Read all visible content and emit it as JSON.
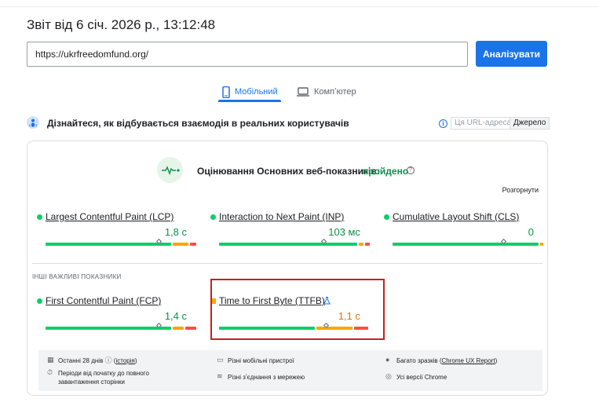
{
  "report": {
    "title": "Звіт від 6 січ. 2026 р., 13:12:48"
  },
  "search": {
    "url_value": "https://ukrfreedomfund.org/",
    "analyze_label": "Аналізувати"
  },
  "tabs": [
    {
      "label": "Мобільний",
      "active": true,
      "icon": "smartphone-icon"
    },
    {
      "label": "Компʼютер",
      "active": false,
      "icon": "laptop-icon"
    }
  ],
  "crux": {
    "heading": "Дізнайтеся, як відбувається взаємодія в реальних користувачів",
    "segment_url": "Ця URL-адреса",
    "segment_origin": "Джерело"
  },
  "assessment": {
    "label": "Оцінювання Основних веб-показників:",
    "result": "пройдено",
    "expand": "Розгорнути"
  },
  "metrics_core": [
    {
      "name": "Largest Contentful Paint (LCP)",
      "value": "1,8 с",
      "status": "good"
    },
    {
      "name": "Interaction to Next Paint (INP)",
      "value": "103 мс",
      "status": "good"
    },
    {
      "name": "Cumulative Layout Shift (CLS)",
      "value": "0",
      "status": "good"
    }
  ],
  "other_label": "ІНШІ ВАЖЛИВІ ПОКАЗНИКИ",
  "metrics_other": [
    {
      "name": "First Contentful Paint (FCP)",
      "value": "1,4 с",
      "status": "good"
    },
    {
      "name": "Time to First Byte (TTFB)",
      "value": "1,1 с",
      "status": "needs-improvement"
    }
  ],
  "footer": {
    "period_prefix": "Останні 28 днів",
    "period_link": "історія",
    "devices": "Різні мобільні пристрої",
    "samples_prefix": "Багато зразків (",
    "samples_link": "Chrome UX Report",
    "samples_suffix": ")",
    "periods": "Періоди від початку до повного завантаження сторінки",
    "connections": "Різні зʼєднання з мережею",
    "versions": "Усі версії Chrome"
  },
  "colors": {
    "accent": "#1a73e8",
    "good": "#0cce6b",
    "average": "#ffa400",
    "poor": "#ff4e42",
    "highlight": "#c5221f"
  }
}
